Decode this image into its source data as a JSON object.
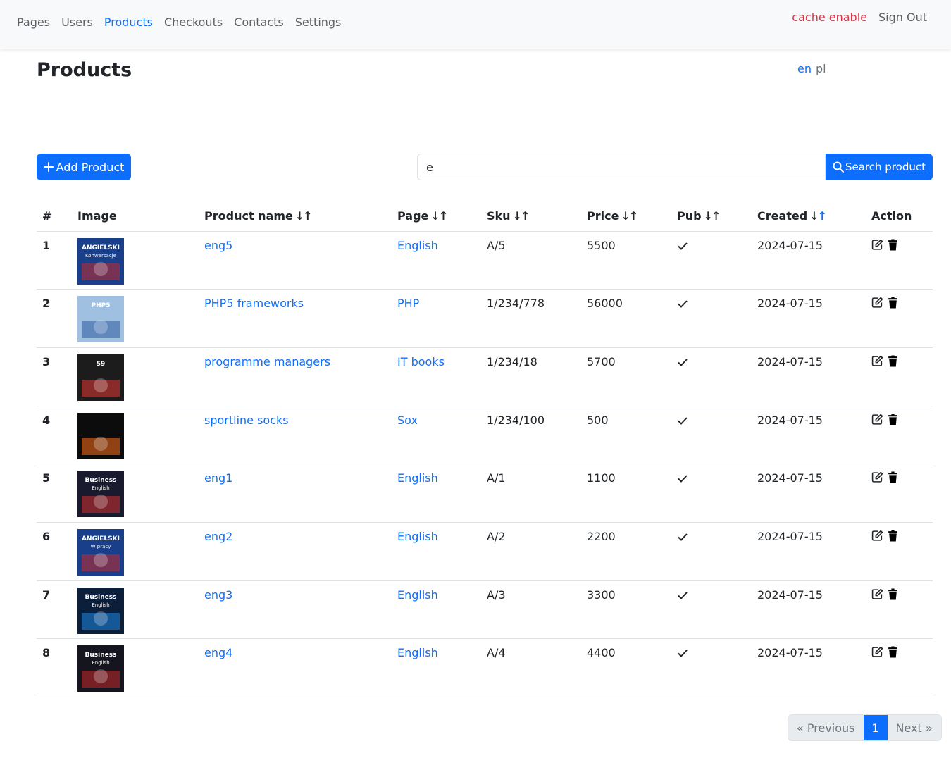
{
  "nav": {
    "items": [
      "Pages",
      "Users",
      "Products",
      "Checkouts",
      "Contacts",
      "Settings"
    ],
    "active": "Products",
    "cache_label": "cache enable",
    "signout_label": "Sign Out"
  },
  "page": {
    "title": "Products",
    "lang_en": "en",
    "lang_pl": "pl"
  },
  "toolbar": {
    "add_label": "Add Product",
    "search_value": "e",
    "search_label": "Search product"
  },
  "table": {
    "headers": {
      "num": "#",
      "image": "Image",
      "name": "Product name",
      "page": "Page",
      "sku": "Sku",
      "price": "Price",
      "pub": "Pub",
      "created": "Created",
      "action": "Action"
    },
    "rows": [
      {
        "num": "1",
        "name": "eng5",
        "page": "English",
        "sku": "A/5",
        "price": "5500",
        "created": "2024-07-15",
        "thumb": "angielski-konwersacje"
      },
      {
        "num": "2",
        "name": "PHP5 frameworks",
        "page": "PHP",
        "sku": "1/234/778",
        "price": "56000",
        "created": "2024-07-15",
        "thumb": "php5"
      },
      {
        "num": "3",
        "name": "programme managers",
        "page": "IT books",
        "sku": "1/234/18",
        "price": "5700",
        "created": "2024-07-15",
        "thumb": "programme"
      },
      {
        "num": "4",
        "name": "sportline socks",
        "page": "Sox",
        "sku": "1/234/100",
        "price": "500",
        "created": "2024-07-15",
        "thumb": "socks"
      },
      {
        "num": "5",
        "name": "eng1",
        "page": "English",
        "sku": "A/1",
        "price": "1100",
        "created": "2024-07-15",
        "thumb": "business-english-red"
      },
      {
        "num": "6",
        "name": "eng2",
        "page": "English",
        "sku": "A/2",
        "price": "2200",
        "created": "2024-07-15",
        "thumb": "angielski-w-pracy"
      },
      {
        "num": "7",
        "name": "eng3",
        "page": "English",
        "sku": "A/3",
        "price": "3300",
        "created": "2024-07-15",
        "thumb": "business-english-blue"
      },
      {
        "num": "8",
        "name": "eng4",
        "page": "English",
        "sku": "A/4",
        "price": "4400",
        "created": "2024-07-15",
        "thumb": "business-english-dark"
      }
    ]
  },
  "pagination": {
    "prev_label": "« Previous",
    "current": "1",
    "next_label": "Next »"
  },
  "colors": {
    "primary": "#0d6efd",
    "danger": "#dc3545",
    "navbar_bg": "#f8f9fa"
  },
  "thumb_art": {
    "angielski-konwersacje": {
      "bg": "#1a3f8a",
      "accent": "#c62828",
      "text1": "ANGIELSKI",
      "text2": "Konwersacje"
    },
    "php5": {
      "bg": "#9fc0e0",
      "accent": "#2d5aa0",
      "text1": "PHP5",
      "text2": ""
    },
    "programme": {
      "bg": "#1c1c1c",
      "accent": "#e53935",
      "text1": "59",
      "text2": ""
    },
    "socks": {
      "bg": "#0c0c0c",
      "accent": "#ff6f1a",
      "text1": "",
      "text2": ""
    },
    "business-english-red": {
      "bg": "#1a1a2e",
      "accent": "#d32f2f",
      "text1": "Business",
      "text2": "English"
    },
    "angielski-w-pracy": {
      "bg": "#1a3f8a",
      "accent": "#c62828",
      "text1": "ANGIELSKI",
      "text2": "W pracy"
    },
    "business-english-blue": {
      "bg": "#0b1e3a",
      "accent": "#1e88e5",
      "text1": "Business",
      "text2": "English"
    },
    "business-english-dark": {
      "bg": "#15151f",
      "accent": "#c62828",
      "text1": "Business",
      "text2": "English"
    }
  }
}
